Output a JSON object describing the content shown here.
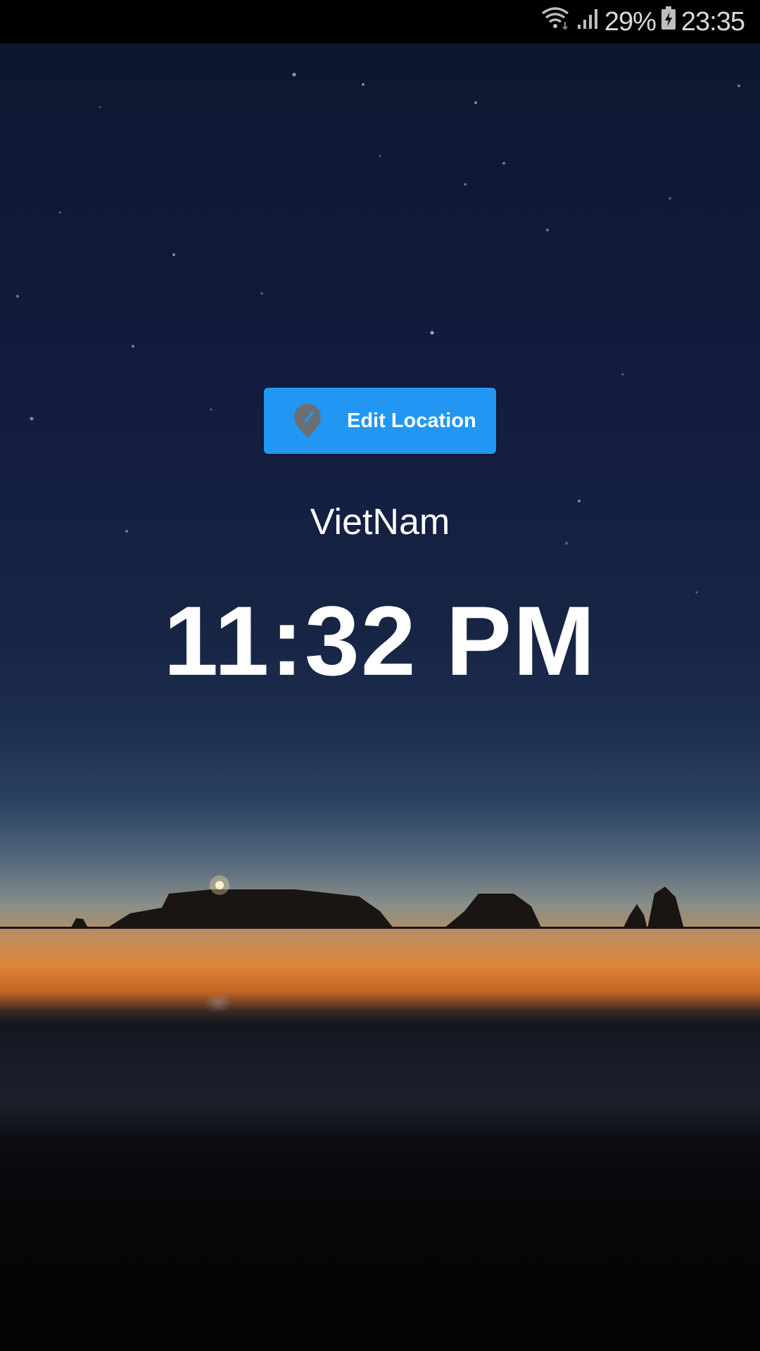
{
  "status_bar": {
    "battery_percent": "29%",
    "clock": "23:35",
    "icons": [
      "wifi-icon",
      "signal-icon",
      "battery-charging-icon"
    ]
  },
  "colors": {
    "button": "#2196f3",
    "text": "#ffffff",
    "status_bar": "#000000"
  },
  "main": {
    "edit_button_label": "Edit Location",
    "edit_button_icon": "location-pin-edit-icon",
    "location": "VietNam",
    "time": "11:32 PM"
  },
  "background": {
    "description_icon": "night-sky-sunset-image"
  }
}
